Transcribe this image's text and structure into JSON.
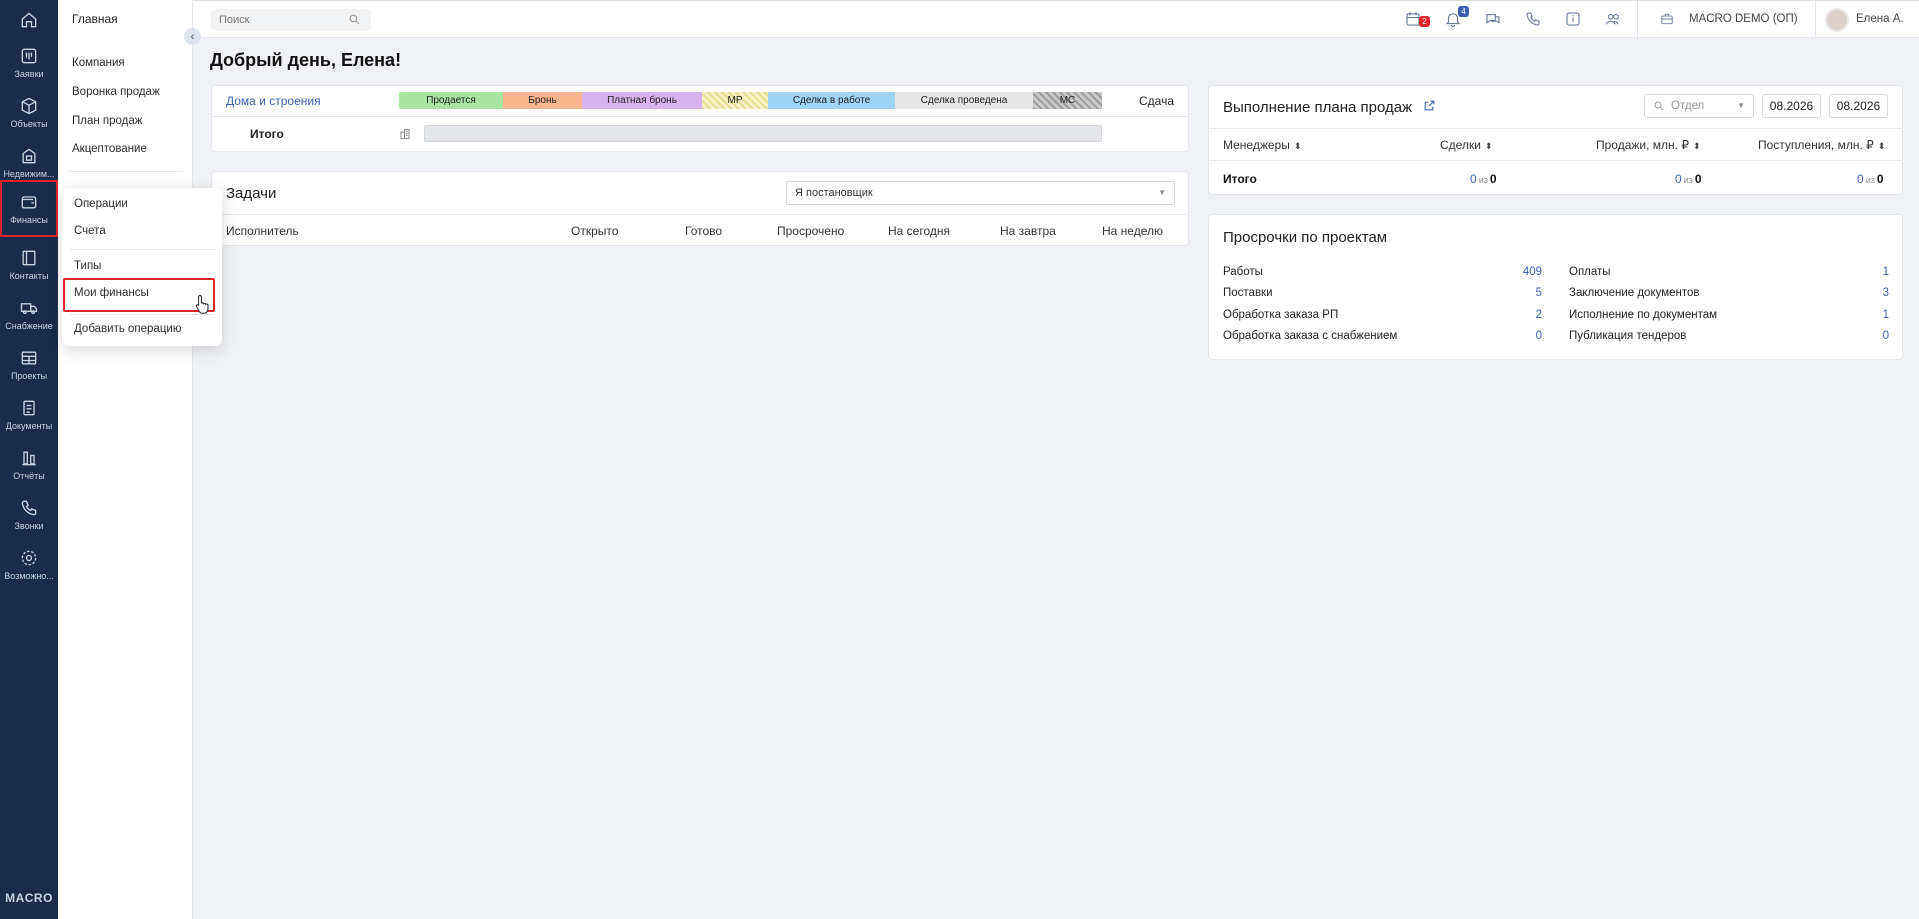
{
  "rail": {
    "items": [
      {
        "label": "",
        "icon": "home-icon"
      },
      {
        "label": "Заявки",
        "icon": "requests-icon"
      },
      {
        "label": "Объекты",
        "icon": "objects-icon"
      },
      {
        "label": "Недвижим...",
        "icon": "realty-icon"
      },
      {
        "label": "Финансы",
        "icon": "wallet-icon"
      },
      {
        "label": "Контакты",
        "icon": "contacts-icon"
      },
      {
        "label": "Снабжение",
        "icon": "truck-icon"
      },
      {
        "label": "Проекты",
        "icon": "projects-icon"
      },
      {
        "label": "Документы",
        "icon": "documents-icon"
      },
      {
        "label": "Отчёты",
        "icon": "reports-icon"
      },
      {
        "label": "Звонки",
        "icon": "phone-icon"
      },
      {
        "label": "Возможно...",
        "icon": "gear-icon"
      }
    ],
    "brand": "MACRO"
  },
  "sidebar": {
    "head": "Главная",
    "items": [
      "Компания",
      "Воронка продаж",
      "План продаж",
      "Акцептование"
    ]
  },
  "popup": {
    "items": [
      "Операции",
      "Счета",
      "Типы",
      "Мои финансы",
      "Добавить операцию"
    ]
  },
  "topbar": {
    "search_placeholder": "Поиск",
    "calendar_badge": "2",
    "bell_badge": "4",
    "company": "MACRO DEMO (ОП)",
    "user": "Елена А."
  },
  "greeting": "Добрый день, Елена!",
  "houses": {
    "link": "Дома и строения",
    "legend": [
      {
        "label": "Продается",
        "color": "#a8e6a1"
      },
      {
        "label": "Бронь",
        "color": "#f8b48c"
      },
      {
        "label": "Платная бронь",
        "color": "#d9b3f0"
      },
      {
        "label": "МР",
        "color": "#f3efb8"
      },
      {
        "label": "Сделка в работе",
        "color": "#9ed4f5"
      },
      {
        "label": "Сделка проведена",
        "color": "#e6e6e6"
      },
      {
        "label": "МС",
        "color": "#b8b8b8"
      }
    ],
    "sdacha": "Сдача",
    "total_label": "Итого"
  },
  "tasks": {
    "title": "Задачи",
    "filter_value": "Я постановщик",
    "columns": [
      "Исполнитель",
      "Открыто",
      "Готово",
      "Просрочено",
      "На сегодня",
      "На завтра",
      "На неделю"
    ]
  },
  "plan": {
    "title": "Выполнение плана продаж",
    "dept_placeholder": "Отдел",
    "date_from": "08.2026",
    "date_to": "08.2026",
    "columns": [
      "Менеджеры",
      "Сделки",
      "Продажи, млн. ₽",
      "Поступления, млн. ₽"
    ],
    "total_label": "Итого",
    "totals": {
      "deals": {
        "a": "0",
        "of": "из",
        "b": "0"
      },
      "sales": {
        "a": "0",
        "of": "из",
        "b": "0"
      },
      "receipts": {
        "a": "0",
        "of": "из",
        "b": "0"
      }
    }
  },
  "overdue": {
    "title": "Просрочки по проектам",
    "left": [
      {
        "label": "Работы",
        "value": "409"
      },
      {
        "label": "Поставки",
        "value": "5"
      },
      {
        "label": "Обработка заказа РП",
        "value": "2"
      },
      {
        "label": "Обработка заказа с снабжением",
        "value": "0"
      }
    ],
    "right": [
      {
        "label": "Оплаты",
        "value": "1"
      },
      {
        "label": "Заключение документов",
        "value": "3"
      },
      {
        "label": "Исполнение по документам",
        "value": "1"
      },
      {
        "label": "Публикация тендеров",
        "value": "0"
      }
    ]
  }
}
